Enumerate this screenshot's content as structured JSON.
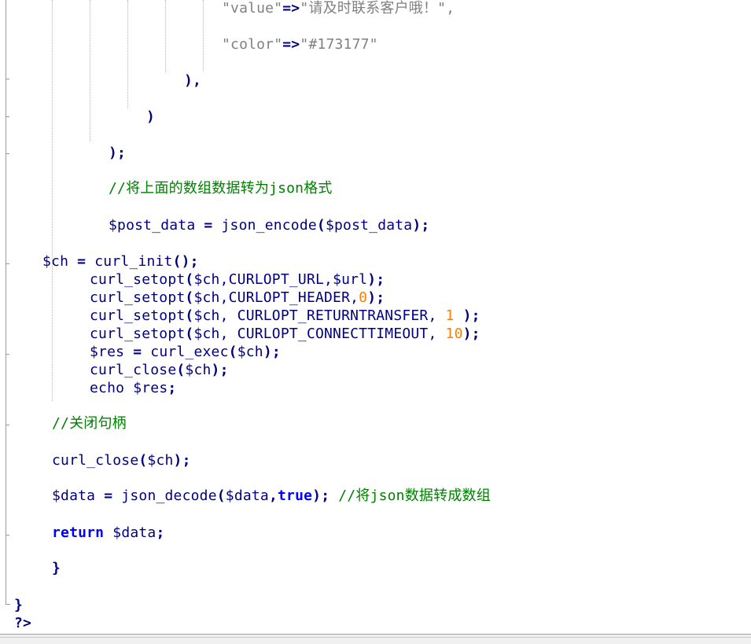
{
  "editor": {
    "lines": [
      {
        "id": "l1",
        "parts": [
          {
            "t": "\"value\"",
            "c": "str"
          },
          {
            "t": "=>",
            "c": "op"
          },
          {
            "t": "\"请及时联系客户哦！\",",
            "c": "str"
          }
        ]
      },
      {
        "id": "l2",
        "parts": [
          {
            "t": "\"color\"",
            "c": "str"
          },
          {
            "t": "=>",
            "c": "op"
          },
          {
            "t": "\"#173177\"",
            "c": "str"
          }
        ]
      },
      {
        "id": "l3",
        "parts": [
          {
            "t": "),",
            "c": "punc"
          }
        ]
      },
      {
        "id": "l4",
        "parts": [
          {
            "t": ")",
            "c": "punc"
          }
        ]
      },
      {
        "id": "l5",
        "parts": [
          {
            "t": ");",
            "c": "punc"
          }
        ]
      },
      {
        "id": "l6",
        "parts": [
          {
            "t": "//将上面的数组数据转为json格式",
            "c": "cmt"
          }
        ]
      },
      {
        "id": "l7",
        "parts": [
          {
            "t": "$post_data",
            "c": "var"
          },
          {
            "t": " ",
            "c": "ws"
          },
          {
            "t": "=",
            "c": "op"
          },
          {
            "t": " ",
            "c": "ws"
          },
          {
            "t": "json_encode",
            "c": "fn"
          },
          {
            "t": "(",
            "c": "punc"
          },
          {
            "t": "$post_data",
            "c": "var"
          },
          {
            "t": ");",
            "c": "punc"
          }
        ]
      },
      {
        "id": "l8",
        "parts": [
          {
            "t": "$ch",
            "c": "var"
          },
          {
            "t": " ",
            "c": "ws"
          },
          {
            "t": "=",
            "c": "op"
          },
          {
            "t": " ",
            "c": "ws"
          },
          {
            "t": "curl_init",
            "c": "fn"
          },
          {
            "t": "();",
            "c": "punc"
          }
        ]
      },
      {
        "id": "l9",
        "parts": [
          {
            "t": "curl_setopt",
            "c": "fn"
          },
          {
            "t": "(",
            "c": "punc"
          },
          {
            "t": "$ch",
            "c": "var"
          },
          {
            "t": ",CURLOPT_URL,",
            "c": "fn"
          },
          {
            "t": "$url",
            "c": "var"
          },
          {
            "t": ");",
            "c": "punc"
          }
        ]
      },
      {
        "id": "l10",
        "parts": [
          {
            "t": "curl_setopt",
            "c": "fn"
          },
          {
            "t": "(",
            "c": "punc"
          },
          {
            "t": "$ch",
            "c": "var"
          },
          {
            "t": ",CURLOPT_HEADER,",
            "c": "fn"
          },
          {
            "t": "0",
            "c": "num"
          },
          {
            "t": ");",
            "c": "punc"
          }
        ]
      },
      {
        "id": "l11",
        "parts": [
          {
            "t": "curl_setopt",
            "c": "fn"
          },
          {
            "t": "(",
            "c": "punc"
          },
          {
            "t": "$ch",
            "c": "var"
          },
          {
            "t": ", CURLOPT_RETURNTRANSFER, ",
            "c": "fn"
          },
          {
            "t": "1",
            "c": "num"
          },
          {
            "t": " );",
            "c": "punc"
          }
        ]
      },
      {
        "id": "l12",
        "parts": [
          {
            "t": "curl_setopt",
            "c": "fn"
          },
          {
            "t": "(",
            "c": "punc"
          },
          {
            "t": "$ch",
            "c": "var"
          },
          {
            "t": ", CURLOPT_CONNECTTIMEOUT, ",
            "c": "fn"
          },
          {
            "t": "10",
            "c": "num"
          },
          {
            "t": ");",
            "c": "punc"
          }
        ]
      },
      {
        "id": "l13",
        "parts": [
          {
            "t": "$res",
            "c": "var"
          },
          {
            "t": " ",
            "c": "ws"
          },
          {
            "t": "=",
            "c": "op"
          },
          {
            "t": " ",
            "c": "ws"
          },
          {
            "t": "curl_exec",
            "c": "fn"
          },
          {
            "t": "(",
            "c": "punc"
          },
          {
            "t": "$ch",
            "c": "var"
          },
          {
            "t": ");",
            "c": "punc"
          }
        ]
      },
      {
        "id": "l14",
        "parts": [
          {
            "t": "curl_close",
            "c": "fn"
          },
          {
            "t": "(",
            "c": "punc"
          },
          {
            "t": "$ch",
            "c": "var"
          },
          {
            "t": ");",
            "c": "punc"
          }
        ]
      },
      {
        "id": "l15",
        "parts": [
          {
            "t": "echo",
            "c": "fn"
          },
          {
            "t": " ",
            "c": "ws"
          },
          {
            "t": "$res",
            "c": "var"
          },
          {
            "t": ";",
            "c": "punc"
          }
        ]
      },
      {
        "id": "l16",
        "parts": [
          {
            "t": "//关闭句柄",
            "c": "cmt"
          }
        ]
      },
      {
        "id": "l17",
        "parts": [
          {
            "t": "curl_close",
            "c": "fn"
          },
          {
            "t": "(",
            "c": "punc"
          },
          {
            "t": "$ch",
            "c": "var"
          },
          {
            "t": ");",
            "c": "punc"
          }
        ]
      },
      {
        "id": "l18",
        "parts": [
          {
            "t": "$data",
            "c": "var"
          },
          {
            "t": " ",
            "c": "ws"
          },
          {
            "t": "=",
            "c": "op"
          },
          {
            "t": " ",
            "c": "ws"
          },
          {
            "t": "json_decode",
            "c": "fn"
          },
          {
            "t": "(",
            "c": "punc"
          },
          {
            "t": "$data",
            "c": "var"
          },
          {
            "t": ",",
            "c": "punc"
          },
          {
            "t": "true",
            "c": "kw"
          },
          {
            "t": ");",
            "c": "punc"
          },
          {
            "t": " ",
            "c": "ws"
          },
          {
            "t": "//将json数据转成数组",
            "c": "cmt"
          }
        ]
      },
      {
        "id": "l19",
        "parts": [
          {
            "t": "return",
            "c": "kw"
          },
          {
            "t": " ",
            "c": "ws"
          },
          {
            "t": "$data",
            "c": "var"
          },
          {
            "t": ";",
            "c": "punc"
          }
        ]
      },
      {
        "id": "l20",
        "parts": [
          {
            "t": "}",
            "c": "punc"
          }
        ]
      },
      {
        "id": "l21",
        "parts": [
          {
            "t": "}",
            "c": "punc"
          }
        ]
      },
      {
        "id": "l22",
        "parts": [
          {
            "t": "?>",
            "c": "punc"
          }
        ]
      }
    ]
  },
  "colors": {
    "string": "#808080",
    "operator": "#000080",
    "variable": "#000080",
    "number": "#ff8000",
    "keyword": "#0000ff",
    "comment": "#008000"
  }
}
